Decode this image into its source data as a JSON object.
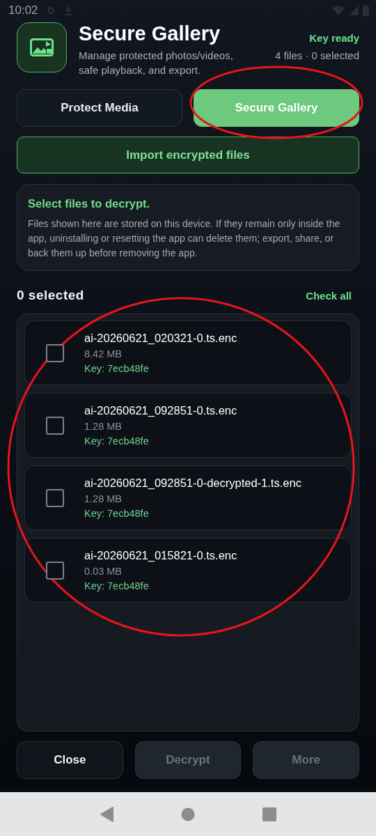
{
  "status_bar": {
    "time": "10:02"
  },
  "header": {
    "title": "Secure Gallery",
    "subtitle": "Manage protected photos/videos, safe playback, and export.",
    "key_status": "Key ready",
    "summary": "4 files · 0 selected"
  },
  "tabs": [
    {
      "label": "Protect Media",
      "selected": false
    },
    {
      "label": "Secure Gallery",
      "selected": true
    }
  ],
  "import_button": "Import encrypted files",
  "info": {
    "title": "Select files to decrypt.",
    "text": "Files shown here are stored on this device. If they remain only inside the app, uninstalling or resetting the app can delete them; export, share, or back them up before removing the app."
  },
  "selection": {
    "count": "0 selected",
    "check_all": "Check all"
  },
  "files": [
    {
      "name": "ai-20260621_020321-0.ts.enc",
      "size": "8.42 MB",
      "key": "Key: 7ecb48fe",
      "checked": false
    },
    {
      "name": "ai-20260621_092851-0.ts.enc",
      "size": "1.28 MB",
      "key": "Key: 7ecb48fe",
      "checked": false
    },
    {
      "name": "ai-20260621_092851-0-decrypted-1.ts.enc",
      "size": "1.28 MB",
      "key": "Key: 7ecb48fe",
      "checked": false
    },
    {
      "name": "ai-20260621_015821-0.ts.enc",
      "size": "0.03 MB",
      "key": "Key: 7ecb48fe",
      "checked": false
    }
  ],
  "buttons": [
    {
      "label": "Close",
      "disabled": false
    },
    {
      "label": "Decrypt",
      "disabled": true
    },
    {
      "label": "More",
      "disabled": true
    }
  ],
  "annotations": [
    {
      "kind": "ellipse",
      "color": "#e8141c"
    },
    {
      "kind": "ellipse",
      "color": "#e8141c"
    }
  ]
}
